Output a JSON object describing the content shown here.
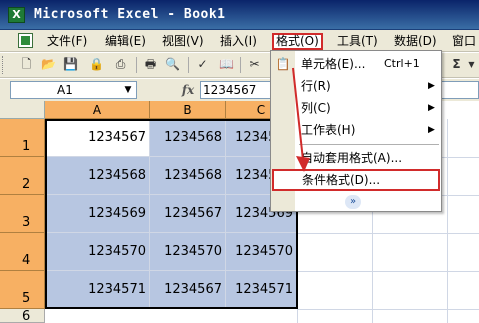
{
  "window": {
    "title": "Microsoft Excel - Book1"
  },
  "menubar": {
    "items": [
      "文件(F)",
      "编辑(E)",
      "视图(V)",
      "插入(I)",
      "格式(O)",
      "工具(T)",
      "数据(D)",
      "窗口"
    ]
  },
  "toolbar": {
    "icons": [
      "new-icon",
      "open-icon",
      "save-icon",
      "permission-icon",
      "print-icon",
      "print-preview-icon",
      "spelling-icon",
      "research-icon",
      "cut-icon",
      "sum-icon"
    ]
  },
  "formula_bar": {
    "name_box": "A1",
    "fx": "fx",
    "formula": "1234567"
  },
  "grid": {
    "columns": [
      "A",
      "B",
      "C"
    ],
    "rows": [
      "1",
      "2",
      "3",
      "4",
      "5",
      "6"
    ],
    "cells": [
      [
        "1234567",
        "1234568",
        "1234567"
      ],
      [
        "1234568",
        "1234568",
        "1234567"
      ],
      [
        "1234569",
        "1234567",
        "1234569"
      ],
      [
        "1234570",
        "1234570",
        "1234570"
      ],
      [
        "1234571",
        "1234567",
        "1234571"
      ]
    ]
  },
  "format_menu": {
    "items": [
      {
        "label": "单元格(E)...",
        "shortcut": "Ctrl+1"
      },
      {
        "label": "行(R)",
        "submenu": "▶"
      },
      {
        "label": "列(C)",
        "submenu": "▶"
      },
      {
        "label": "工作表(H)",
        "submenu": "▶"
      },
      {
        "label": "自动套用格式(A)..."
      },
      {
        "label": "条件格式(D)..."
      }
    ],
    "expand": "»"
  }
}
